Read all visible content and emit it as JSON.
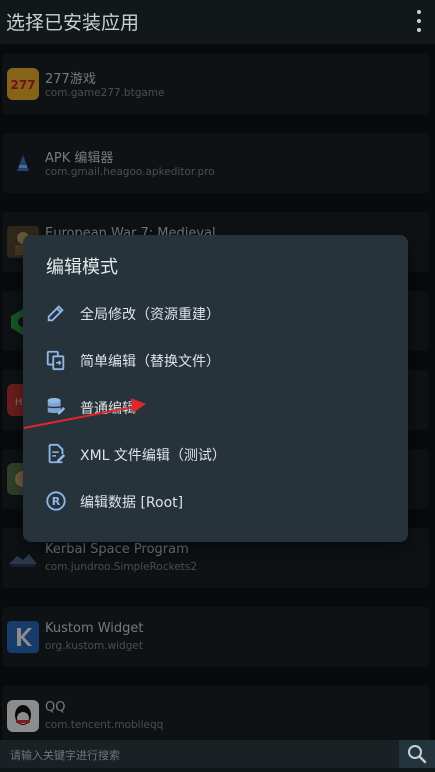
{
  "header": {
    "title": "选择已安装应用",
    "menu_icon": "more-vertical-icon"
  },
  "apps": [
    {
      "name": "277游戏",
      "package": "com.game277.btgame",
      "icon": "game277-app-icon",
      "color": "#f2a12b"
    },
    {
      "name": "APK 编辑器",
      "package": "com.gmail.heagoo.apkeditor.pro",
      "icon": "apk-editor-app-icon",
      "color": "#3a7bd5"
    },
    {
      "name": "European War 7: Medieval",
      "package": "",
      "icon": "european-war-app-icon",
      "color": "#6b5a3a"
    },
    {
      "name": "",
      "package": "",
      "icon": "green-app-icon",
      "color": "#2fa14a"
    },
    {
      "name": "",
      "package": "",
      "icon": "red-app-icon",
      "color": "#c8383a"
    },
    {
      "name": "",
      "package": "",
      "icon": "game-app-icon",
      "color": "#6a8a5a"
    },
    {
      "name": "Kerbal Space Program",
      "package": "com.jundroo.SimpleRockets2",
      "icon": "simplerockets-app-icon",
      "color": "#2a3d58"
    },
    {
      "name": "Kustom Widget",
      "package": "org.kustom.widget",
      "icon": "kustom-app-icon",
      "color": "#2b6cc4"
    },
    {
      "name": "QQ",
      "package": "com.tencent.mobileqq",
      "icon": "qq-app-icon",
      "color": "#ffffff"
    }
  ],
  "dialog": {
    "title": "编辑模式",
    "options": [
      {
        "label": "全局修改（资源重建）",
        "icon": "pencil-icon"
      },
      {
        "label": "简单编辑（替换文件）",
        "icon": "file-replace-icon"
      },
      {
        "label": "普通编辑",
        "icon": "database-edit-icon"
      },
      {
        "label": "XML 文件编辑（测试）",
        "icon": "file-edit-icon"
      },
      {
        "label": "编辑数据 [Root]",
        "icon": "root-r-icon"
      }
    ],
    "accent": "#8fb7e8"
  },
  "annotation": {
    "color": "#e0262b"
  },
  "search": {
    "placeholder": "请输入关键字进行搜索",
    "icon": "search-icon"
  }
}
